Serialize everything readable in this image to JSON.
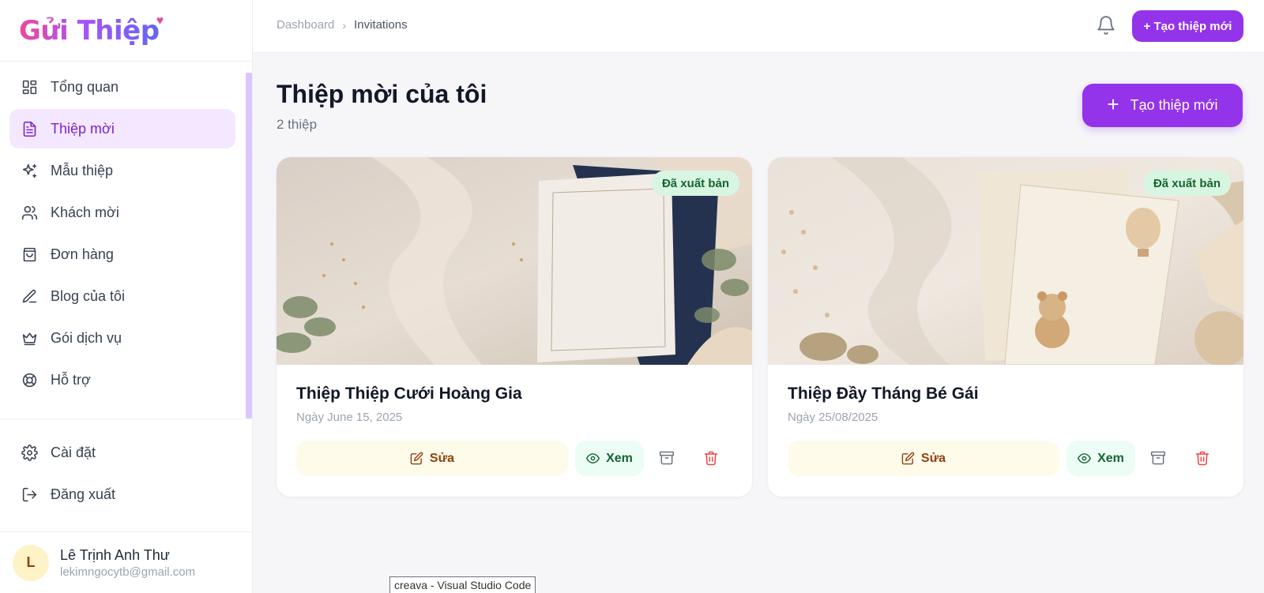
{
  "app": {
    "logo_text": "Gửi Thiệp",
    "brand_color": "#9333ea"
  },
  "sidebar": {
    "items": [
      {
        "label": "Tổng quan",
        "icon": "dashboard-icon",
        "active": false
      },
      {
        "label": "Thiệp mời",
        "icon": "document-icon",
        "active": true
      },
      {
        "label": "Mẫu thiệp",
        "icon": "sparkles-icon",
        "active": false
      },
      {
        "label": "Khách mời",
        "icon": "users-icon",
        "active": false
      },
      {
        "label": "Đơn hàng",
        "icon": "shopping-bag-icon",
        "active": false
      },
      {
        "label": "Blog của tôi",
        "icon": "pen-icon",
        "active": false
      },
      {
        "label": "Gói dịch vụ",
        "icon": "crown-icon",
        "active": false
      },
      {
        "label": "Hỗ trợ",
        "icon": "lifebuoy-icon",
        "active": false
      }
    ],
    "bottom_items": [
      {
        "label": "Cài đặt",
        "icon": "gear-icon"
      },
      {
        "label": "Đăng xuất",
        "icon": "logout-icon"
      }
    ],
    "user": {
      "initial": "L",
      "name": "Lê Trịnh Anh Thư",
      "email": "lekimngocytb@gmail.com"
    }
  },
  "topbar": {
    "breadcrumb": [
      "Dashboard",
      "Invitations"
    ],
    "create_label": "+ Tạo thiệp mới"
  },
  "main": {
    "title": "Thiệp mời của tôi",
    "count": "2 thiệp",
    "create_label": "Tạo thiệp mới",
    "cards": [
      {
        "title": "Thiệp Thiệp Cưới Hoàng Gia",
        "date": "Ngày June 15, 2025",
        "status": "Đã xuất bản",
        "edit_label": "Sửa",
        "view_label": "Xem"
      },
      {
        "title": "Thiệp Đầy Tháng Bé Gái",
        "date": "Ngày 25/08/2025",
        "status": "Đã xuất bản",
        "edit_label": "Sửa",
        "view_label": "Xem"
      }
    ]
  },
  "tooltip": "creava - Visual Studio Code"
}
